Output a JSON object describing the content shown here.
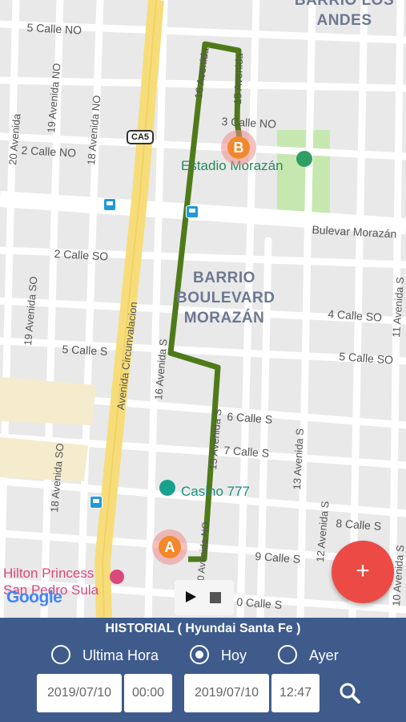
{
  "map": {
    "streets": [
      "5 Calle NO",
      "3 Calle NO",
      "2 Calle NO",
      "2 Calle SO",
      "5 Calle S",
      "4 Calle SO",
      "5 Calle SO",
      "6 Calle S",
      "7 Calle S",
      "8 Calle S",
      "9 Calle S",
      "0 Calle S",
      "Bulevar Morazán",
      "Avenida Circunvalacion",
      "16 Avenida S",
      "15 Avenida S",
      "13 Avenida S",
      "12 Avenida S",
      "11 Avenida S",
      "10 Avenida S",
      "19 Avenida SO",
      "18 Avenida SO",
      "19 Avenida NO",
      "18 Avenida NO",
      "20 Avenida",
      "10 Avenida NO",
      "16 Avenida",
      "15 Avenida"
    ],
    "highway_shield": "CA5",
    "districts": [
      {
        "text": "BARRIO LOS\nANDES"
      },
      {
        "text": "BARRIO\nBOULEVARD\nMORAZÁN"
      }
    ],
    "pois": {
      "stadium": "Estadio Morazán",
      "casino": "Casino 777",
      "hotel": "Hilton Princess\nSan Pedro Sula"
    },
    "markers": {
      "start": "A",
      "end": "B"
    },
    "attribution": "Google"
  },
  "controls": {
    "fab": "+"
  },
  "panel": {
    "title": "HISTORIAL ( Hyundai Santa Fe )",
    "options": [
      {
        "label": "Ultima Hora",
        "checked": false
      },
      {
        "label": "Hoy",
        "checked": true
      },
      {
        "label": "Ayer",
        "checked": false
      }
    ],
    "from_date": "2019/07/10",
    "from_time": "00:00",
    "to_date": "2019/07/10",
    "to_time": "12:47"
  },
  "colors": {
    "route": "#4f7a1a",
    "fab": "#ec4b45",
    "panel": "#3e5b8c",
    "marker": "#f2882b",
    "park": "#c6e8b0"
  }
}
